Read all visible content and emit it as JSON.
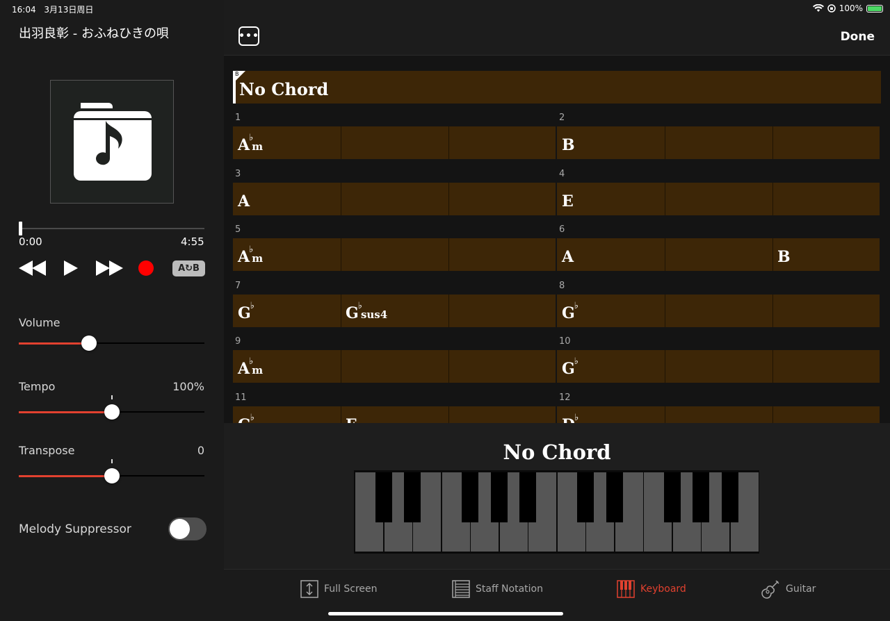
{
  "status": {
    "time": "16:04",
    "date": "3月13日周日",
    "battery": "100%"
  },
  "player": {
    "song_title": "出羽良彰 - おふねひきの唄",
    "time_current": "0:00",
    "time_total": "4:55",
    "progress": 0.0,
    "ab_label": "A↻B"
  },
  "controls": {
    "volume": {
      "label": "Volume",
      "level": 0.38
    },
    "tempo": {
      "label": "Tempo",
      "value": "100%",
      "level": 0.5
    },
    "transpose": {
      "label": "Transpose",
      "value": "0",
      "level": 0.5
    },
    "melody_suppressor": {
      "label": "Melody Suppressor",
      "on": false
    }
  },
  "header": {
    "more_label": "•••",
    "done_label": "Done"
  },
  "chart": {
    "section_marker": "B",
    "intro_chord": "No Chord",
    "measures": [
      {
        "num": "1",
        "chords": [
          {
            "root": "A",
            "flat": true,
            "qual": "m",
            "beat": 0
          }
        ]
      },
      {
        "num": "2",
        "chords": [
          {
            "root": "B",
            "flat": false,
            "qual": "",
            "beat": 0
          }
        ]
      },
      {
        "num": "3",
        "chords": [
          {
            "root": "A",
            "flat": false,
            "qual": "",
            "beat": 0
          }
        ]
      },
      {
        "num": "4",
        "chords": [
          {
            "root": "E",
            "flat": false,
            "qual": "",
            "beat": 0
          }
        ]
      },
      {
        "num": "5",
        "chords": [
          {
            "root": "A",
            "flat": true,
            "qual": "m",
            "beat": 0
          }
        ]
      },
      {
        "num": "6",
        "chords": [
          {
            "root": "A",
            "flat": false,
            "qual": "",
            "beat": 0
          },
          {
            "root": "B",
            "flat": false,
            "qual": "",
            "beat": 2
          }
        ]
      },
      {
        "num": "7",
        "chords": [
          {
            "root": "G",
            "flat": true,
            "qual": "",
            "beat": 0
          },
          {
            "root": "G",
            "flat": true,
            "qual": "sus4",
            "beat": 1
          }
        ]
      },
      {
        "num": "8",
        "chords": [
          {
            "root": "G",
            "flat": true,
            "qual": "",
            "beat": 0
          }
        ]
      },
      {
        "num": "9",
        "chords": [
          {
            "root": "A",
            "flat": true,
            "qual": "m",
            "beat": 0
          }
        ]
      },
      {
        "num": "10",
        "chords": [
          {
            "root": "G",
            "flat": true,
            "qual": "",
            "beat": 0
          }
        ]
      },
      {
        "num": "11",
        "chords": [
          {
            "root": "G",
            "flat": true,
            "qual": "",
            "beat": 0
          },
          {
            "root": "F",
            "flat": false,
            "qual": "",
            "beat": 1
          }
        ]
      },
      {
        "num": "12",
        "chords": [
          {
            "root": "D",
            "flat": true,
            "qual": "",
            "beat": 0
          }
        ]
      }
    ]
  },
  "keyboard_view": {
    "current_chord": "No Chord"
  },
  "tabs": [
    {
      "label": "Full Screen",
      "icon": "full-screen-icon",
      "active": false
    },
    {
      "label": "Staff Notation",
      "icon": "staff-notation-icon",
      "active": false
    },
    {
      "label": "Keyboard",
      "icon": "keyboard-icon",
      "active": true
    },
    {
      "label": "Guitar",
      "icon": "guitar-icon",
      "active": false
    }
  ],
  "colors": {
    "accent": "#e2412f",
    "chord_bar": "#3d2607",
    "record": "#ff0000"
  }
}
